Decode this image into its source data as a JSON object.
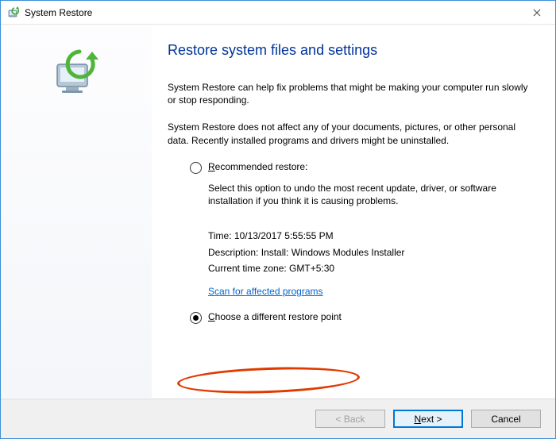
{
  "titlebar": {
    "title": "System Restore"
  },
  "content": {
    "heading": "Restore system files and settings",
    "paragraph1": "System Restore can help fix problems that might be making your computer run slowly or stop responding.",
    "paragraph2": "System Restore does not affect any of your documents, pictures, or other personal data. Recently installed programs and drivers might be uninstalled."
  },
  "options": {
    "recommended": {
      "label": "Recommended restore:",
      "description": "Select this option to undo the most recent update, driver, or software installation if you think it is causing problems.",
      "time_label": "Time: 10/13/2017 5:55:55 PM",
      "desc_label": "Description: Install: Windows Modules Installer",
      "tz_label": "Current time zone: GMT+5:30",
      "scan_link": "Scan for affected programs",
      "selected": false
    },
    "choose_different": {
      "label": "Choose a different restore point",
      "selected": true
    }
  },
  "footer": {
    "back": "< Back",
    "next": "Next >",
    "cancel": "Cancel"
  }
}
